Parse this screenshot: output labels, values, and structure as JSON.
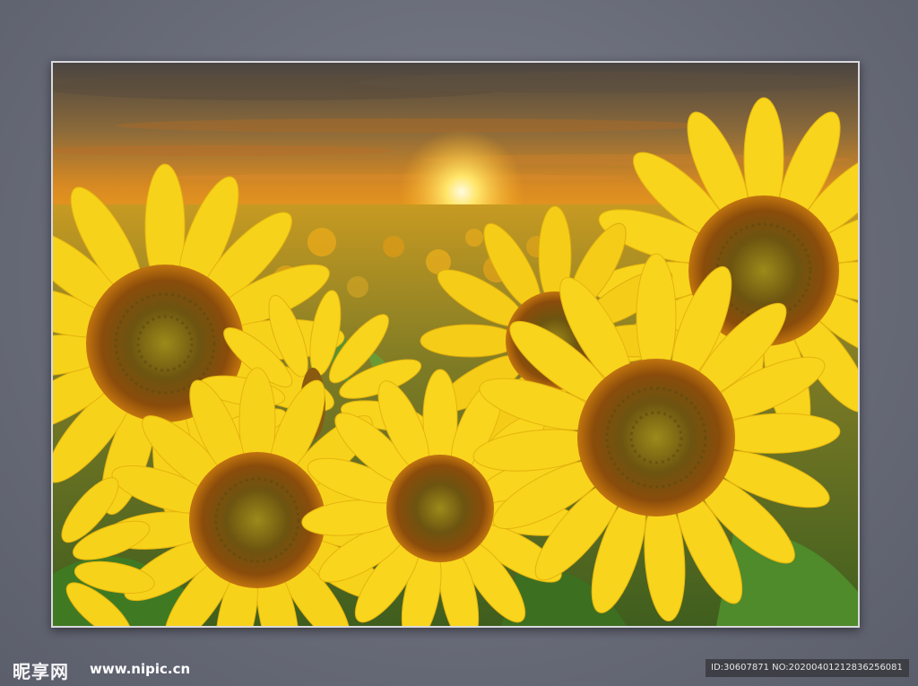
{
  "watermark": {
    "logo_text": "昵享网",
    "url_text": "www.nipic.cn"
  },
  "id_bar": {
    "text": "ID:30607871 NO:20200401212836256081"
  },
  "colors": {
    "wall": "#666977",
    "frame_border": "#d9d9dd",
    "sky_top": "#3f3b3a",
    "sky_glow": "#f4a414",
    "petal": "#f7d21a",
    "petal_dark": "#e8b40d",
    "center_outer": "#a35d0c",
    "center_inner": "#7f6b14",
    "leaf": "#4f8a2b"
  },
  "picture": {
    "subject": "sunflower-field-at-sunset"
  }
}
